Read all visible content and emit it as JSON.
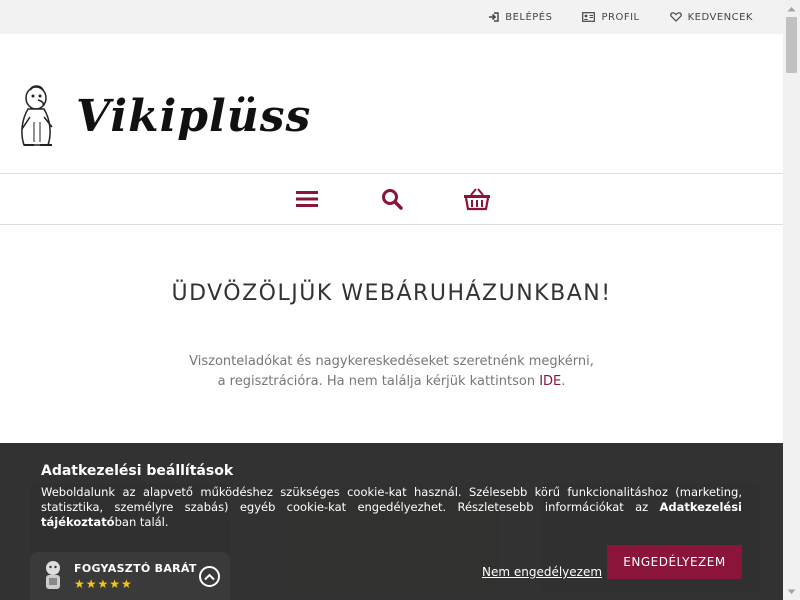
{
  "topbar": {
    "login_label": "BELÉPÉS",
    "profile_label": "PROFIL",
    "favorites_label": "KEDVENCEK"
  },
  "header": {
    "logo_text": "Vikiplüss",
    "nav_icons": [
      "menu-icon",
      "search-icon",
      "basket-icon"
    ]
  },
  "welcome": {
    "title": "ÜDVÖZÖLJÜK WEBÁRUHÁZUNKBAN!",
    "line1": "Viszonteladókat és nagykereskedéseket szeretnénk megkérni,",
    "line2_before": "a regisztrációra. Ha nem találja kérjük kattintson ",
    "line2_link": "IDE",
    "line2_after": "."
  },
  "cookie": {
    "title": "Adatkezelési beállítások",
    "text_main": "Weboldalunk az alapvető működéshez szükséges cookie-kat használ. Szélesebb körű funkcionalitáshoz (marketing, statisztika, személyre szabás) egyéb cookie-kat engedélyezhet. Részletesebb információkat az ",
    "text_bold": "Adatkezelési tájékoztató",
    "text_end": "ban talál.",
    "decline_label": "Nem engedélyezem",
    "accept_label": "ENGEDÉLYEZEM"
  },
  "badge": {
    "title": "FOGYASZTÓ BARÁT",
    "stars": "★★★★★"
  },
  "colors": {
    "accent": "#8a1538",
    "topbar_bg": "#f2f2f2",
    "cookie_bg": "#222222",
    "star": "#f5c518"
  }
}
